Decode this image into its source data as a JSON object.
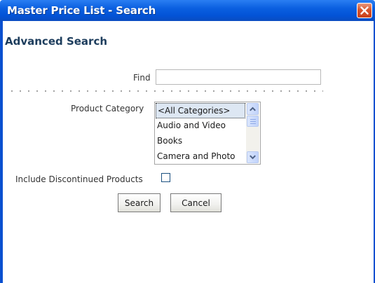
{
  "window": {
    "title": "Master Price List - Search"
  },
  "form": {
    "heading": "Advanced Search",
    "find_label": "Find",
    "find_value": "",
    "category_label": "Product Category",
    "categories": [
      {
        "label": "<All Categories>",
        "selected": true
      },
      {
        "label": "Audio and Video",
        "selected": false
      },
      {
        "label": "Books",
        "selected": false
      },
      {
        "label": "Camera and Photo",
        "selected": false
      }
    ],
    "discontinued_label": "Include Discontinued Products",
    "discontinued_checked": false,
    "search_button": "Search",
    "cancel_button": "Cancel"
  },
  "colors": {
    "titlebar": "#0353d6",
    "heading": "#1d3d5d",
    "close": "#d8542c"
  },
  "icons": {
    "close": "close-icon",
    "scroll_up": "chevron-up-icon",
    "scroll_down": "chevron-down-icon"
  }
}
